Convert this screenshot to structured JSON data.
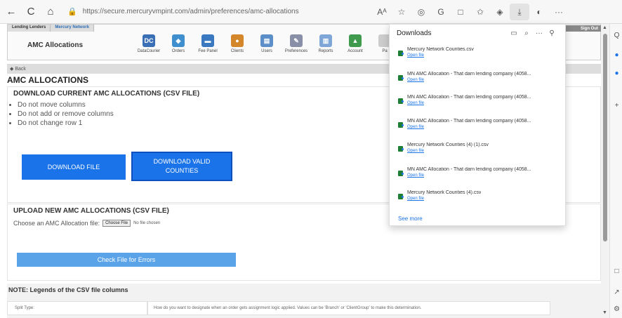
{
  "browser": {
    "url": "https://secure.mercuryvmpint.com/admin/preferences/amc-allocations",
    "lock_glyph": "🔒",
    "back_glyph": "←",
    "reload_glyph": "C",
    "home_glyph": "⌂",
    "toolbar_glyphs": [
      "Aᴬ",
      "☆",
      "◎",
      "G",
      "□",
      "✩",
      "◈",
      "⤓",
      "◐",
      "···"
    ],
    "rail_glyphs": [
      "Q",
      "●",
      "●",
      "+",
      "□",
      "↗",
      "⚙"
    ]
  },
  "app": {
    "crumb_tabs": [
      "Lending Lenders",
      "Mercury Network"
    ],
    "module_title": "AMC Allocations",
    "nav": [
      {
        "label": "DataCourier",
        "glyph": "DC",
        "color": "#3a6fb5"
      },
      {
        "label": "Orders",
        "glyph": "◆",
        "color": "#3f8fce"
      },
      {
        "label": "Fee Panel",
        "glyph": "▬",
        "color": "#3a79c0"
      },
      {
        "label": "Clients",
        "glyph": "●",
        "color": "#d4862b"
      },
      {
        "label": "Users",
        "glyph": "▤",
        "color": "#5c8fc9"
      },
      {
        "label": "Preferences",
        "glyph": "✎",
        "color": "#8a8fa8"
      },
      {
        "label": "Reports",
        "glyph": "▥",
        "color": "#7ea6d6"
      },
      {
        "label": "Account",
        "glyph": "▲",
        "color": "#3f9a4d"
      },
      {
        "label": "Pa",
        "glyph": "",
        "color": "#cccccc"
      }
    ],
    "sign_out": "Sign Out",
    "back_label": "◆ Back"
  },
  "page": {
    "title": "AMC ALLOCATIONS",
    "download_section": {
      "heading": "DOWNLOAD CURRENT AMC ALLOCATIONS (CSV FILE)",
      "rules": [
        "Do not move columns",
        "Do not add or remove columns",
        "Do not change row 1"
      ],
      "download_file_label": "DOWNLOAD FILE",
      "download_counties_label": "DOWNLOAD VALID COUNTIES"
    },
    "upload_section": {
      "heading": "UPLOAD NEW AMC ALLOCATIONS (CSV FILE)",
      "choose_label": "Choose an AMC Allocation file:",
      "choose_button": "Choose File",
      "no_file": "No file chosen",
      "check_button": "Check File for Errors"
    },
    "note": {
      "heading": "NOTE: Legends of the CSV file columns",
      "legend_key": "Split Type:",
      "legend_value": "How do you want to designate when an order gets assignment logic applied. Values can be 'Branch' or 'ClientGroup' to make this determination."
    }
  },
  "downloads": {
    "title": "Downloads",
    "head_glyphs": [
      "▭",
      "⌕",
      "···",
      "⚲"
    ],
    "open_label": "Open file",
    "items": [
      {
        "name": "Mercury Network Counties.csv"
      },
      {
        "name": "MN AMC Allocation - That darn lending company (4058..."
      },
      {
        "name": "MN AMC Allocation - That darn lending company (4058..."
      },
      {
        "name": "MN AMC Allocation - That darn lending company (4058..."
      },
      {
        "name": "Mercury Network Counties (4) (1).csv"
      },
      {
        "name": "MN AMC Allocation - That darn lending company (4058..."
      },
      {
        "name": "Mercury Network Counties (4).csv"
      }
    ],
    "see_more": "See more"
  }
}
